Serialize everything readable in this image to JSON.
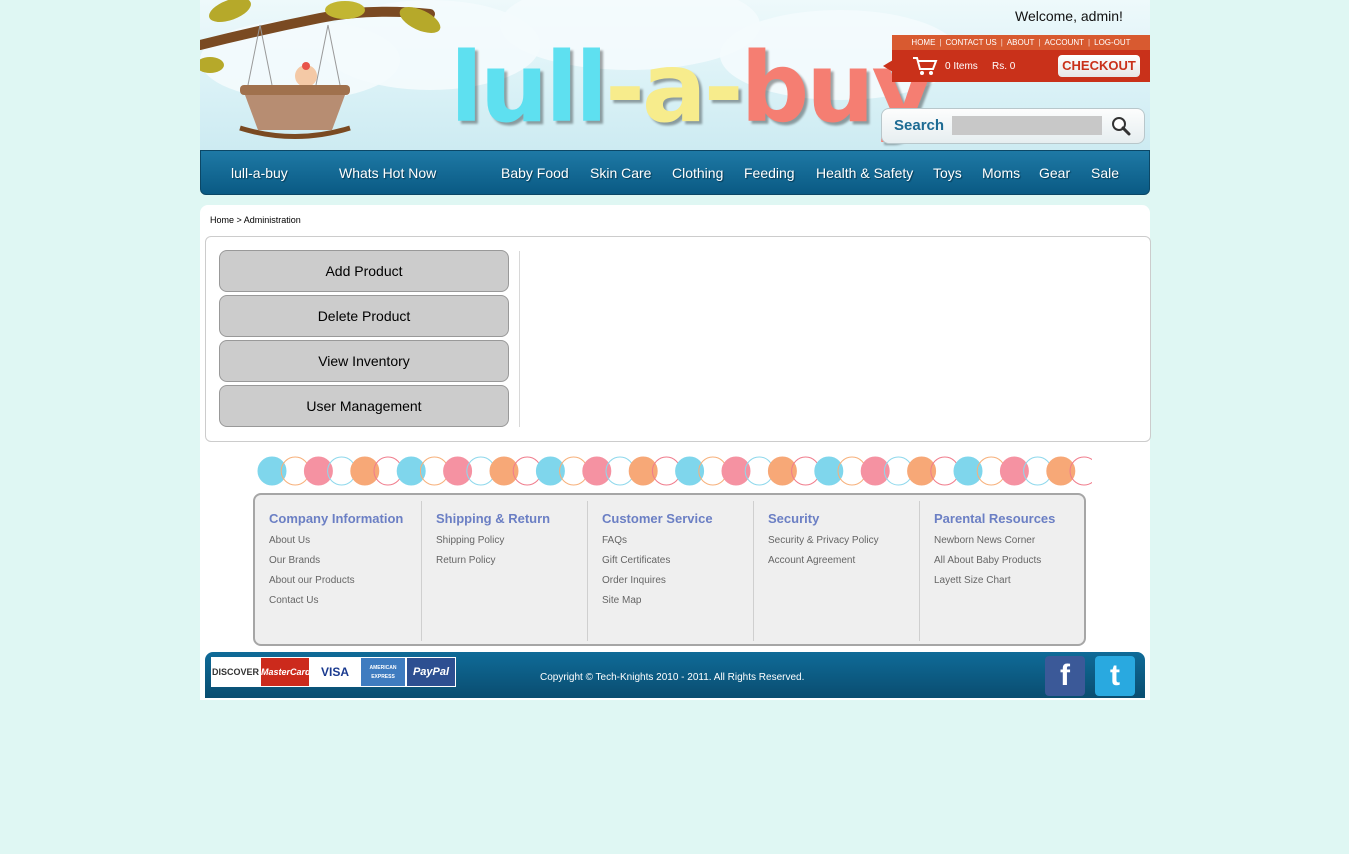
{
  "header": {
    "logo_text": "lull-a-buy",
    "logo_parts": [
      "lull",
      "-a-",
      "buy"
    ],
    "welcome": "Welcome, admin!",
    "top_links": [
      "HOME",
      "CONTACT US",
      "ABOUT",
      "ACCOUNT",
      "LOG-OUT"
    ],
    "cart_items": "0 Items",
    "cart_total": "Rs. 0",
    "checkout_label": "CHECKOUT",
    "search_label": "Search",
    "search_value": "",
    "colors": {
      "brand_cyan": "#5ee0f0",
      "brand_yellow": "#f7ec8c",
      "brand_coral": "#f57e72",
      "accent_red": "#c9311a"
    }
  },
  "nav": {
    "items": [
      "lull-a-buy",
      "Whats Hot Now",
      "Baby Food",
      "Skin Care",
      "Clothing",
      "Feeding",
      "Health & Safety",
      "Toys",
      "Moms",
      "Gear",
      "Sale"
    ]
  },
  "breadcrumb": "Home > Administration",
  "admin": {
    "buttons": [
      "Add Product",
      "Delete Product",
      "View Inventory",
      "User Management"
    ]
  },
  "footer": {
    "columns": [
      {
        "title": "Company Information",
        "links": [
          "About Us",
          "Our Brands",
          "About our Products",
          "Contact Us"
        ]
      },
      {
        "title": "Shipping & Return",
        "links": [
          "Shipping Policy",
          "Return Policy"
        ]
      },
      {
        "title": "Customer Service",
        "links": [
          "FAQs",
          "Gift Certificates",
          "Order Inquires",
          "Site Map"
        ]
      },
      {
        "title": "Security",
        "links": [
          "Security & Privacy Policy",
          "Account Agreement"
        ]
      },
      {
        "title": "Parental Resources",
        "links": [
          "Newborn News Corner",
          "All About Baby Products",
          "Layett Size Chart"
        ]
      }
    ],
    "payment_methods": [
      "DISCOVER",
      "MasterCard",
      "VISA",
      "AMERICAN EXPRESS",
      "PayPal"
    ],
    "copyright": "Copyright © Tech-Knights 2010 - 2011. All Rights Reserved.",
    "social": [
      {
        "label": "f",
        "icon": "facebook-icon",
        "color": "#3b5998"
      },
      {
        "label": "t",
        "icon": "twitter-icon",
        "color": "#29a9e0"
      }
    ]
  }
}
